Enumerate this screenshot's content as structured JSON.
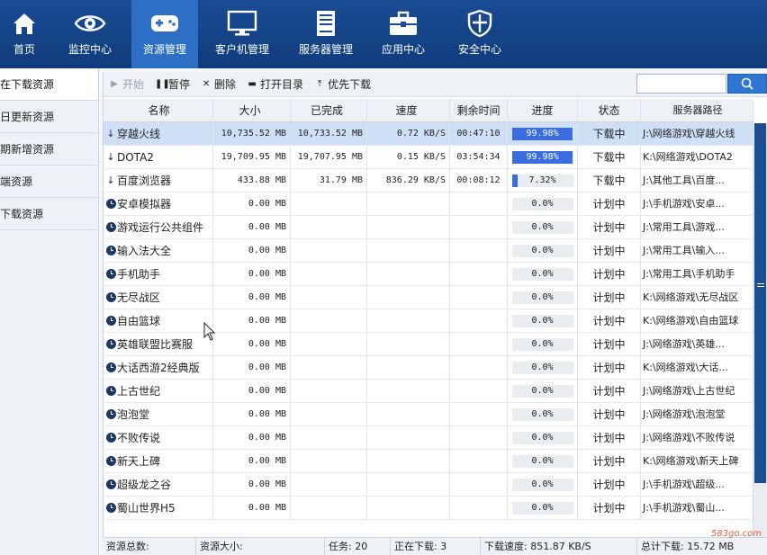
{
  "nav": [
    {
      "label": "首页",
      "icon": "home-icon",
      "active": false
    },
    {
      "label": "监控中心",
      "icon": "eye-icon",
      "active": false
    },
    {
      "label": "资源管理",
      "icon": "gamepad-icon",
      "active": true
    },
    {
      "label": "客户机管理",
      "icon": "monitor-icon",
      "active": false
    },
    {
      "label": "服务器管理",
      "icon": "server-icon",
      "active": false
    },
    {
      "label": "应用中心",
      "icon": "toolbox-icon",
      "active": false
    },
    {
      "label": "安全中心",
      "icon": "shield-icon",
      "active": false
    }
  ],
  "sidebar": {
    "items": [
      {
        "label": "在下载资源",
        "active": true
      },
      {
        "label": "日更新资源",
        "active": false
      },
      {
        "label": "期新增资源",
        "active": false
      },
      {
        "label": "端资源",
        "active": false
      },
      {
        "label": "下载资源",
        "active": false
      }
    ]
  },
  "toolbar": {
    "start": "开始",
    "pause": "暂停",
    "delete": "删除",
    "open_dir": "打开目录",
    "priority": "优先下载",
    "search_placeholder": ""
  },
  "table": {
    "columns": [
      "名称",
      "大小",
      "已完成",
      "速度",
      "剩余时间",
      "进度",
      "状态",
      "服务器路径"
    ],
    "rows": [
      {
        "name": "穿越火线",
        "icon": "download-arrow-icon",
        "size": "10,735.52 MB",
        "done": "10,733.52 MB",
        "speed": "0.72 KB/S",
        "remain": "00:47:10",
        "progress": "99.98%",
        "progress_value": 0.9998,
        "status": "下载中",
        "path": "J:\\网络游戏\\穿越火线",
        "selected": true
      },
      {
        "name": "DOTA2",
        "icon": "download-arrow-icon",
        "size": "19,709.95 MB",
        "done": "19,707.95 MB",
        "speed": "0.15 KB/S",
        "remain": "03:54:34",
        "progress": "99.98%",
        "progress_value": 0.9998,
        "status": "下载中",
        "path": "K:\\网络游戏\\DOTA2",
        "selected": false
      },
      {
        "name": "百度浏览器",
        "icon": "download-arrow-icon",
        "size": "433.88 MB",
        "done": "31.79 MB",
        "speed": "836.29 KB/S",
        "remain": "00:08:12",
        "progress": "7.32%",
        "progress_value": 0.0732,
        "status": "下载中",
        "path": "J:\\其他工具\\百度...",
        "selected": false
      },
      {
        "name": "安卓模拟器",
        "icon": "clock-icon",
        "size": "0.00 MB",
        "done": "",
        "speed": "",
        "remain": "",
        "progress": "0.0%",
        "progress_value": 0,
        "status": "计划中",
        "path": "J:\\手机游戏\\安卓...",
        "selected": false
      },
      {
        "name": "游戏运行公共组件",
        "icon": "clock-icon",
        "size": "0.00 MB",
        "done": "",
        "speed": "",
        "remain": "",
        "progress": "0.0%",
        "progress_value": 0,
        "status": "计划中",
        "path": "J:\\常用工具\\游戏...",
        "selected": false
      },
      {
        "name": "输入法大全",
        "icon": "clock-icon",
        "size": "0.00 MB",
        "done": "",
        "speed": "",
        "remain": "",
        "progress": "0.0%",
        "progress_value": 0,
        "status": "计划中",
        "path": "J:\\常用工具\\输入...",
        "selected": false
      },
      {
        "name": "手机助手",
        "icon": "clock-icon",
        "size": "0.00 MB",
        "done": "",
        "speed": "",
        "remain": "",
        "progress": "0.0%",
        "progress_value": 0,
        "status": "计划中",
        "path": "J:\\常用工具\\手机助手",
        "selected": false
      },
      {
        "name": "无尽战区",
        "icon": "clock-icon",
        "size": "0.00 MB",
        "done": "",
        "speed": "",
        "remain": "",
        "progress": "0.0%",
        "progress_value": 0,
        "status": "计划中",
        "path": "K:\\网络游戏\\无尽战区",
        "selected": false
      },
      {
        "name": "自由篮球",
        "icon": "clock-icon",
        "size": "0.00 MB",
        "done": "",
        "speed": "",
        "remain": "",
        "progress": "0.0%",
        "progress_value": 0,
        "status": "计划中",
        "path": "K:\\网络游戏\\自由篮球",
        "selected": false
      },
      {
        "name": "英雄联盟比赛服",
        "icon": "clock-icon",
        "size": "0.00 MB",
        "done": "",
        "speed": "",
        "remain": "",
        "progress": "0.0%",
        "progress_value": 0,
        "status": "计划中",
        "path": "J:\\网络游戏\\英雄...",
        "selected": false
      },
      {
        "name": "大话西游2经典版",
        "icon": "clock-icon",
        "size": "0.00 MB",
        "done": "",
        "speed": "",
        "remain": "",
        "progress": "0.0%",
        "progress_value": 0,
        "status": "计划中",
        "path": "K:\\网络游戏\\大话...",
        "selected": false
      },
      {
        "name": "上古世纪",
        "icon": "clock-icon",
        "size": "0.00 MB",
        "done": "",
        "speed": "",
        "remain": "",
        "progress": "0.0%",
        "progress_value": 0,
        "status": "计划中",
        "path": "J:\\网络游戏\\上古世纪",
        "selected": false
      },
      {
        "name": "泡泡堂",
        "icon": "clock-icon",
        "size": "0.00 MB",
        "done": "",
        "speed": "",
        "remain": "",
        "progress": "0.0%",
        "progress_value": 0,
        "status": "计划中",
        "path": "J:\\网络游戏\\泡泡堂",
        "selected": false
      },
      {
        "name": "不败传说",
        "icon": "clock-icon",
        "size": "0.00 MB",
        "done": "",
        "speed": "",
        "remain": "",
        "progress": "0.0%",
        "progress_value": 0,
        "status": "计划中",
        "path": "J:\\网络游戏\\不败传说",
        "selected": false
      },
      {
        "name": "新天上碑",
        "icon": "clock-icon",
        "size": "0.00 MB",
        "done": "",
        "speed": "",
        "remain": "",
        "progress": "0.0%",
        "progress_value": 0,
        "status": "计划中",
        "path": "K:\\网络游戏\\新天上碑",
        "selected": false
      },
      {
        "name": "超级龙之谷",
        "icon": "clock-icon",
        "size": "0.00 MB",
        "done": "",
        "speed": "",
        "remain": "",
        "progress": "0.0%",
        "progress_value": 0,
        "status": "计划中",
        "path": "J:\\手机游戏\\超级...",
        "selected": false
      },
      {
        "name": "蜀山世界H5",
        "icon": "clock-icon",
        "size": "0.00 MB",
        "done": "",
        "speed": "",
        "remain": "",
        "progress": "0.0%",
        "progress_value": 0,
        "status": "计划中",
        "path": "J:\\手机游戏\\蜀山...",
        "selected": false
      }
    ]
  },
  "statusbar": {
    "total_resources": "资源总数:",
    "resource_size": "资源大小:",
    "tasks": "任务: 20",
    "downloading": "正在下载: 3",
    "speed": "下载速度: 851.87 KB/S",
    "total_download": "总计下载: 15.72 MB"
  },
  "watermark": "583go.com",
  "colors": {
    "nav_bg": "#1a4c93",
    "nav_active": "#2c6fc4",
    "progress_fill": "#3a6ee0",
    "selected_row": "#cfe0f6"
  }
}
